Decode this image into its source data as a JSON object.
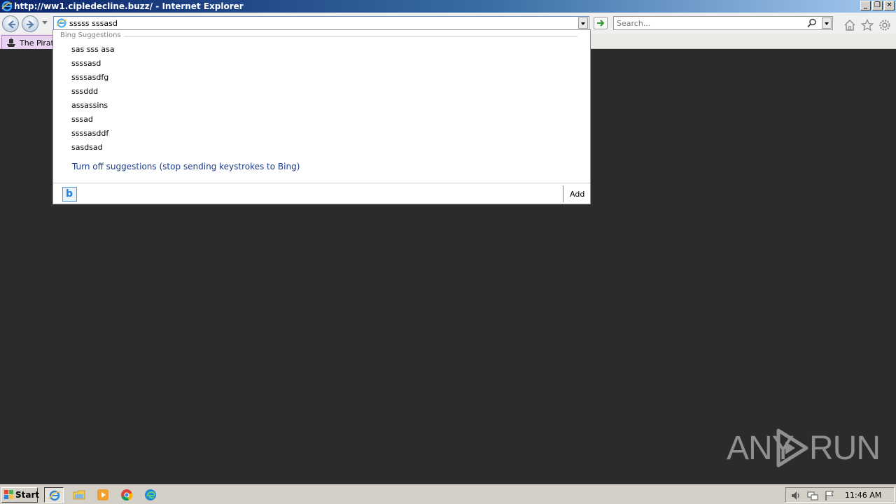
{
  "window": {
    "title": "http://ww1.cipledecline.buzz/ - Internet Explorer",
    "controls": [
      "_",
      "❐",
      "✕"
    ]
  },
  "addressbar": {
    "value": "sssss sssasd"
  },
  "search": {
    "placeholder": "Search..."
  },
  "tabs": [
    {
      "label": "The Pirate"
    }
  ],
  "suggestions": {
    "group_title": "Bing Suggestions",
    "items": [
      "sas sss asa",
      "ssssasd",
      "ssssasdfg",
      "sssddd",
      "assassins",
      "sssad",
      "ssssasddf",
      "sasdsad"
    ],
    "turn_off_label": "Turn off suggestions (stop sending keystrokes to Bing)",
    "provider_icon": "bing-icon",
    "add_label": "Add"
  },
  "toolbar_icons": [
    "back-icon",
    "forward-icon",
    "go-icon",
    "home-icon",
    "favorites-star-icon",
    "settings-gear-icon"
  ],
  "taskbar": {
    "start_label": "Start",
    "apps": [
      "internet-explorer-icon",
      "file-explorer-icon",
      "media-player-icon",
      "chrome-icon",
      "edge-icon"
    ],
    "clock": "11:46 AM"
  },
  "watermark": {
    "left": "ANY",
    "right": "RUN"
  },
  "colors": {
    "titlebar_start": "#0a246a",
    "titlebar_end": "#a6caf0",
    "desktop": "#2b2b2b",
    "link": "#1a3a8a",
    "tab_active": "#e8d4f0"
  }
}
